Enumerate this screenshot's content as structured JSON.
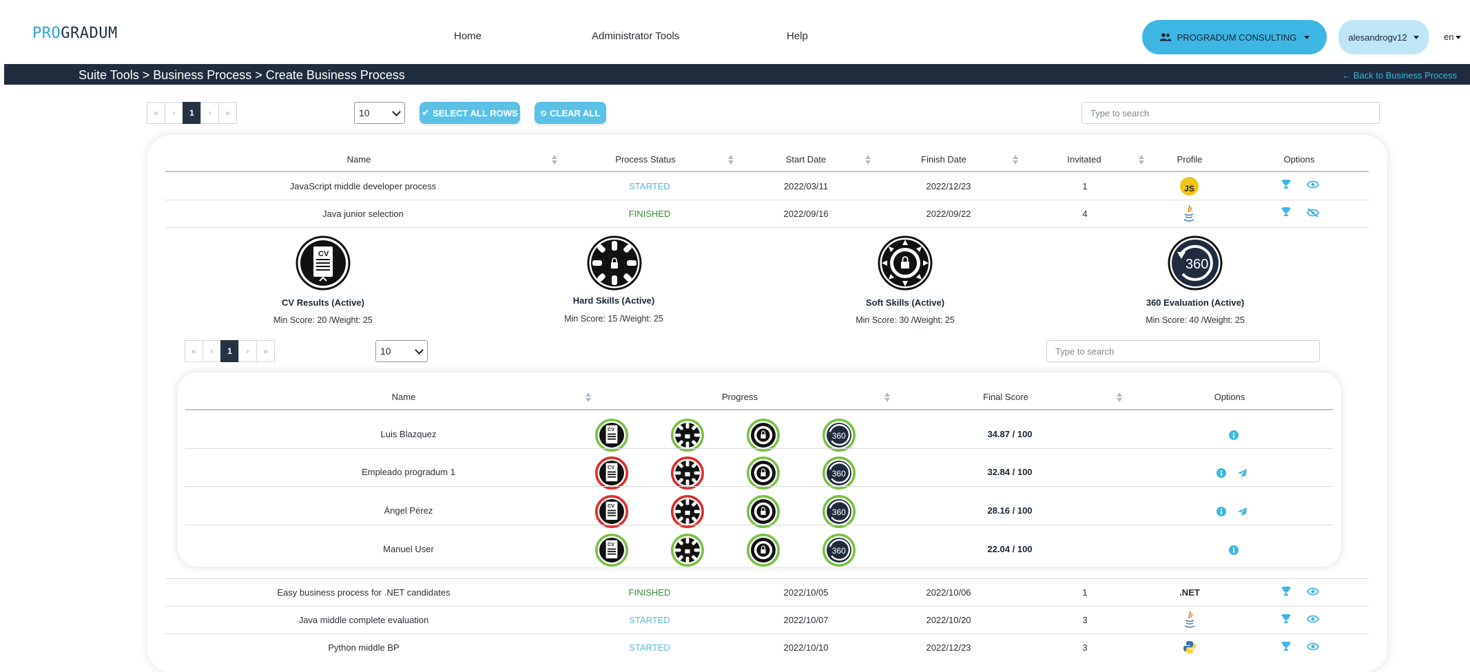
{
  "brand": {
    "part1": "PRO",
    "part2": "GRADUM"
  },
  "nav": {
    "home": "Home",
    "admin": "Administrator Tools",
    "help": "Help"
  },
  "account": {
    "company": "PROGRADUM CONSULTING",
    "user": "alesandrogv12",
    "lang": "en"
  },
  "breadcrumb": {
    "text": "Suite Tools > Business Process > Create Business Process",
    "back": "Back to Business Process"
  },
  "toolbar": {
    "pager": [
      "«",
      "‹",
      "1",
      "›",
      "»"
    ],
    "page_size": "10",
    "select_all": "SELECT ALL ROWS",
    "clear_all": "CLEAR ALL",
    "search_placeholder": "Type to search"
  },
  "table": {
    "headers": [
      "Name",
      "Process Status",
      "Start Date",
      "Finish Date",
      "Invitated",
      "Profile",
      "Options"
    ],
    "rows": [
      {
        "name": "JavaScript middle developer process",
        "status": "STARTED",
        "start": "2022/03/11",
        "finish": "2022/12/23",
        "invited": "1",
        "profile": "JS"
      },
      {
        "name": "Java junior selection",
        "status": "FINISHED",
        "start": "2022/09/16",
        "finish": "2022/09/22",
        "invited": "4",
        "profile": "java"
      },
      {
        "name": "Easy business process for .NET candidates",
        "status": "FINISHED",
        "start": "2022/10/05",
        "finish": "2022/10/06",
        "invited": "1",
        "profile": ".NET"
      },
      {
        "name": "Java middle complete evaluation",
        "status": "STARTED",
        "start": "2022/10/07",
        "finish": "2022/10/20",
        "invited": "3",
        "profile": "java"
      },
      {
        "name": "Python middle BP",
        "status": "STARTED",
        "start": "2022/10/10",
        "finish": "2022/12/23",
        "invited": "3",
        "profile": "python"
      }
    ]
  },
  "phases": [
    {
      "icon": "cv-icon",
      "name": "CV Results (Active)",
      "meta": "Min Score: 20 /Weight: 25",
      "icon_text": "CV"
    },
    {
      "icon": "gear-icon",
      "name": "Hard Skills (Active)",
      "meta": "Min Score: 15 /Weight: 25"
    },
    {
      "icon": "sun-gear-icon",
      "name": "Soft Skills (Active)",
      "meta": "Min Score: 30 /Weight: 25"
    },
    {
      "icon": "360-icon",
      "name": "360 Evaluation (Active)",
      "meta": "Min Score: 40 /Weight: 25",
      "icon_text": "360"
    }
  ],
  "inner": {
    "pager": [
      "«",
      "‹",
      "1",
      "›",
      "»"
    ],
    "page_size": "10",
    "search_placeholder": "Type to search",
    "headers": [
      "Name",
      "Progress",
      "Final Score",
      "Options"
    ],
    "rows": [
      {
        "name": "Luis Blazquez",
        "score": "34.87 / 100",
        "rings": [
          "#7ac143",
          "#7ac143",
          "#7ac143",
          "#7ac143"
        ],
        "send": false
      },
      {
        "name": "Empleado progradum 1",
        "score": "32.84 / 100",
        "rings": [
          "#e32b2b",
          "#e32b2b",
          "#7ac143",
          "#7ac143"
        ],
        "send": true
      },
      {
        "name": "Ángel Pérez",
        "score": "28.16 / 100",
        "rings": [
          "#e32b2b",
          "#e32b2b",
          "#7ac143",
          "#7ac143"
        ],
        "send": true
      },
      {
        "name": "Manuel User",
        "score": "22.04 / 100",
        "rings": [
          "#7ac143",
          "#7ac143",
          "#7ac143",
          "#7ac143"
        ],
        "send": false
      }
    ]
  },
  "colors": {
    "accent": "#3eb6e4",
    "navy": "#1f2c3d",
    "green": "#7ac143",
    "red": "#e32b2b"
  }
}
